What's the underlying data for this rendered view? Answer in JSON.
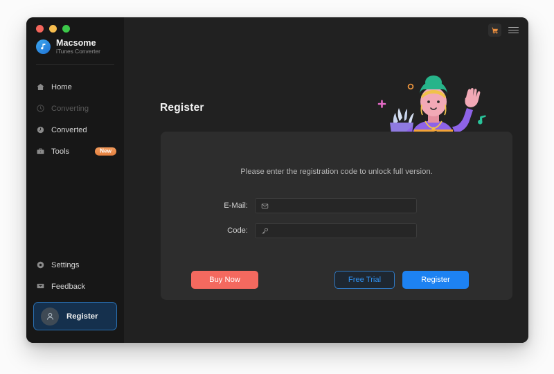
{
  "window": {
    "traffic_lights": [
      "close",
      "minimize",
      "maximize"
    ]
  },
  "brand": {
    "name": "Macsome",
    "subtitle": "iTunes Converter",
    "logo_icon": "music-note-circle-icon"
  },
  "titlebar": {
    "cart_icon": "shopping-cart-icon",
    "menu_icon": "hamburger-menu-icon"
  },
  "sidebar": {
    "top_items": [
      {
        "label": "Home",
        "icon": "home-icon",
        "state": "normal"
      },
      {
        "label": "Converting",
        "icon": "converting-icon",
        "state": "disabled"
      },
      {
        "label": "Converted",
        "icon": "clock-icon",
        "state": "normal"
      },
      {
        "label": "Tools",
        "icon": "toolbox-icon",
        "state": "normal",
        "badge": "New"
      }
    ],
    "bottom_items": [
      {
        "label": "Settings",
        "icon": "gear-icon"
      },
      {
        "label": "Feedback",
        "icon": "message-icon"
      }
    ],
    "register_entry": {
      "label": "Register",
      "icon": "user-avatar-icon",
      "selected": true
    }
  },
  "main": {
    "page_title": "Register",
    "illustration": "person-waving-at-laptop-illustration"
  },
  "card": {
    "hint": "Please enter the registration code to unlock full version.",
    "fields": [
      {
        "label": "E-Mail:",
        "icon": "envelope-icon",
        "value": "",
        "placeholder": ""
      },
      {
        "label": "Code:",
        "icon": "key-icon",
        "value": "",
        "placeholder": ""
      }
    ],
    "buttons": {
      "buy_now": "Buy Now",
      "free_trial": "Free Trial",
      "register": "Register"
    }
  },
  "colors": {
    "page_background": "#fbfbfb",
    "window_background": "#212121",
    "sidebar_background": "#171717",
    "card_background": "#2d2d2d",
    "accent_blue": "#1d82f2",
    "accent_red": "#f4695f",
    "accent_orange": "#ec8f3e",
    "selected_nav_fill": "#15304d",
    "selected_nav_border": "#2a6fb0"
  }
}
